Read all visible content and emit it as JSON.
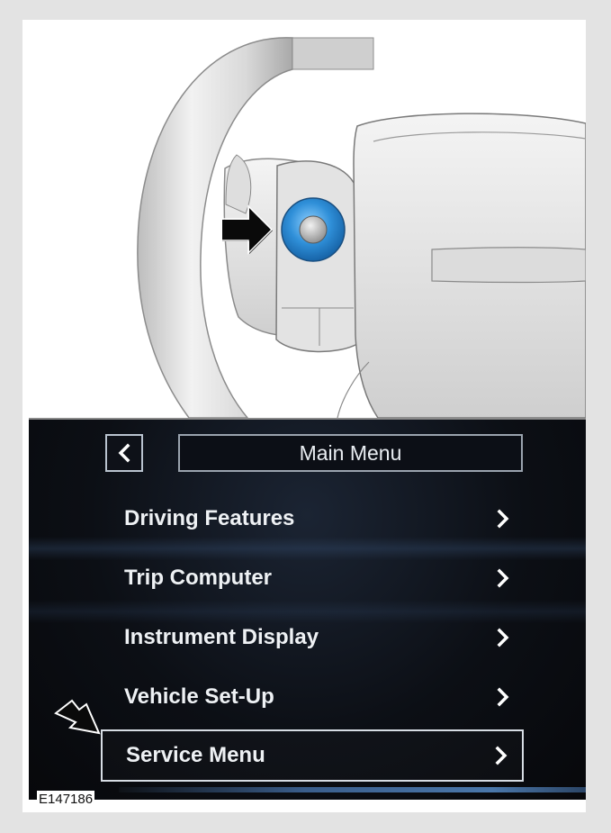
{
  "illustration": {
    "subject": "steering-wheel-control",
    "accent_color": "#2f8fd8"
  },
  "screen": {
    "header": {
      "back_icon": "chevron-left-icon",
      "title": "Main Menu"
    },
    "menu_items": [
      {
        "label": "Driving Features",
        "icon": "chevron-right-icon",
        "selected": false
      },
      {
        "label": "Trip Computer",
        "icon": "chevron-right-icon",
        "selected": false
      },
      {
        "label": "Instrument Display",
        "icon": "chevron-right-icon",
        "selected": false
      },
      {
        "label": "Vehicle Set-Up",
        "icon": "chevron-right-icon",
        "selected": false
      },
      {
        "label": "Service Menu",
        "icon": "chevron-right-icon",
        "selected": true
      }
    ]
  },
  "figure_ref": "E147186"
}
